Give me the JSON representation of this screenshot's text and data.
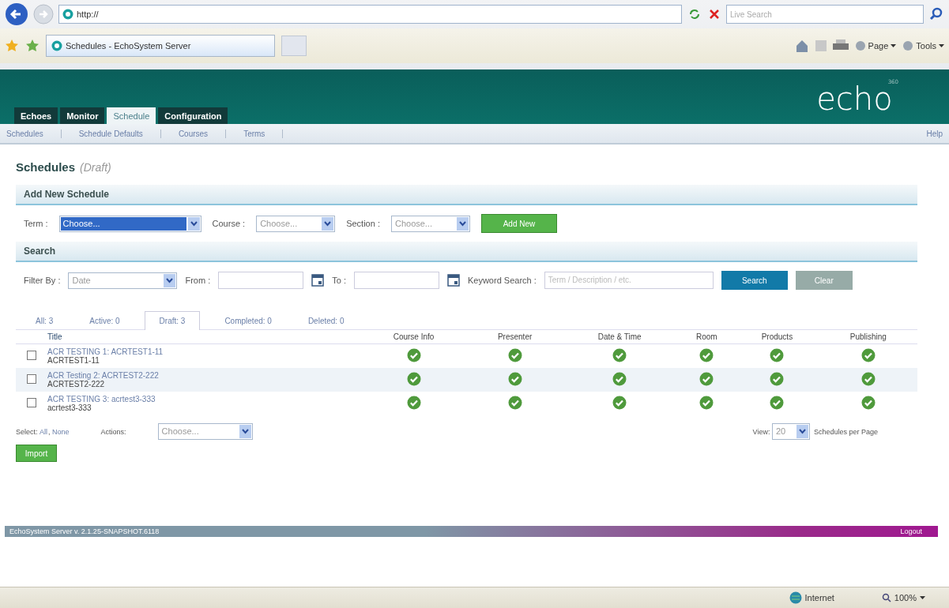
{
  "browser": {
    "address": "http://",
    "tab_title": "Schedules - EchoSystem Server",
    "search_placeholder": "Live Search",
    "commands": [
      {
        "label": "Page"
      },
      {
        "label": "Tools"
      }
    ]
  },
  "header": {
    "logo": "echo",
    "logo_sup": "360",
    "tabs": [
      {
        "label": "Echoes",
        "selected": false
      },
      {
        "label": "Monitor",
        "selected": false
      },
      {
        "label": "Schedule",
        "selected": true
      },
      {
        "label": "Configuration",
        "selected": false
      }
    ],
    "subnav": [
      "Schedules",
      "Schedule Defaults",
      "Courses",
      "Terms"
    ],
    "help": "Help"
  },
  "page_title": "Schedules",
  "page_subtitle": "(Draft)",
  "add_new": {
    "heading": "Add New Schedule",
    "fields": [
      {
        "label": "Term :",
        "value": "Choose...",
        "focused": true
      },
      {
        "label": "Course :",
        "value": "Choose...",
        "focused": false
      },
      {
        "label": "Section :",
        "value": "Choose...",
        "focused": false
      }
    ],
    "button": "Add New"
  },
  "search": {
    "heading": "Search",
    "filter_label": "Filter By :",
    "filter_value": "Date",
    "from_label": "From :",
    "to_label": "To :",
    "keyword_label": "Keyword Search :",
    "keyword_placeholder": "Term / Description / etc.",
    "search_button": "Search",
    "clear_button": "Clear"
  },
  "status_tabs": [
    {
      "label": "All: 3",
      "selected": false
    },
    {
      "label": "Active: 0",
      "selected": false
    },
    {
      "label": "Draft: 3",
      "selected": true
    },
    {
      "label": "Completed: 0",
      "selected": false
    },
    {
      "label": "Deleted: 0",
      "selected": false
    }
  ],
  "table": {
    "columns": [
      "Title",
      "Course Info",
      "Presenter",
      "Date & Time",
      "Room",
      "Products",
      "Publishing"
    ],
    "rows": [
      {
        "title": "ACR TESTING 1: ACRTEST1-11",
        "code": "ACRTEST1-11",
        "checked": false,
        "complete": [
          true,
          true,
          true,
          true,
          true,
          true
        ]
      },
      {
        "title": "ACR Testing 2: ACRTEST2-222",
        "code": "ACRTEST2-222",
        "checked": false,
        "complete": [
          true,
          true,
          true,
          true,
          true,
          true
        ]
      },
      {
        "title": "ACR TESTING 3: acrtest3-333",
        "code": "acrtest3-333",
        "checked": false,
        "complete": [
          true,
          true,
          true,
          true,
          true,
          true
        ]
      }
    ]
  },
  "bulk": {
    "select_label": "Select:",
    "select_all": "All",
    "select_separator": ",",
    "select_none": "None",
    "actions_label": "Actions:",
    "actions_value": "Choose...",
    "view_label": "View:",
    "view_value": "20",
    "per_page": "Schedules per Page",
    "import_button": "Import"
  },
  "footer": {
    "version": "EchoSystem Server v. 2.1.25-SNAPSHOT.6118",
    "logout": "Logout"
  },
  "status_bar": {
    "zone": "Internet",
    "zoom": "100%"
  }
}
